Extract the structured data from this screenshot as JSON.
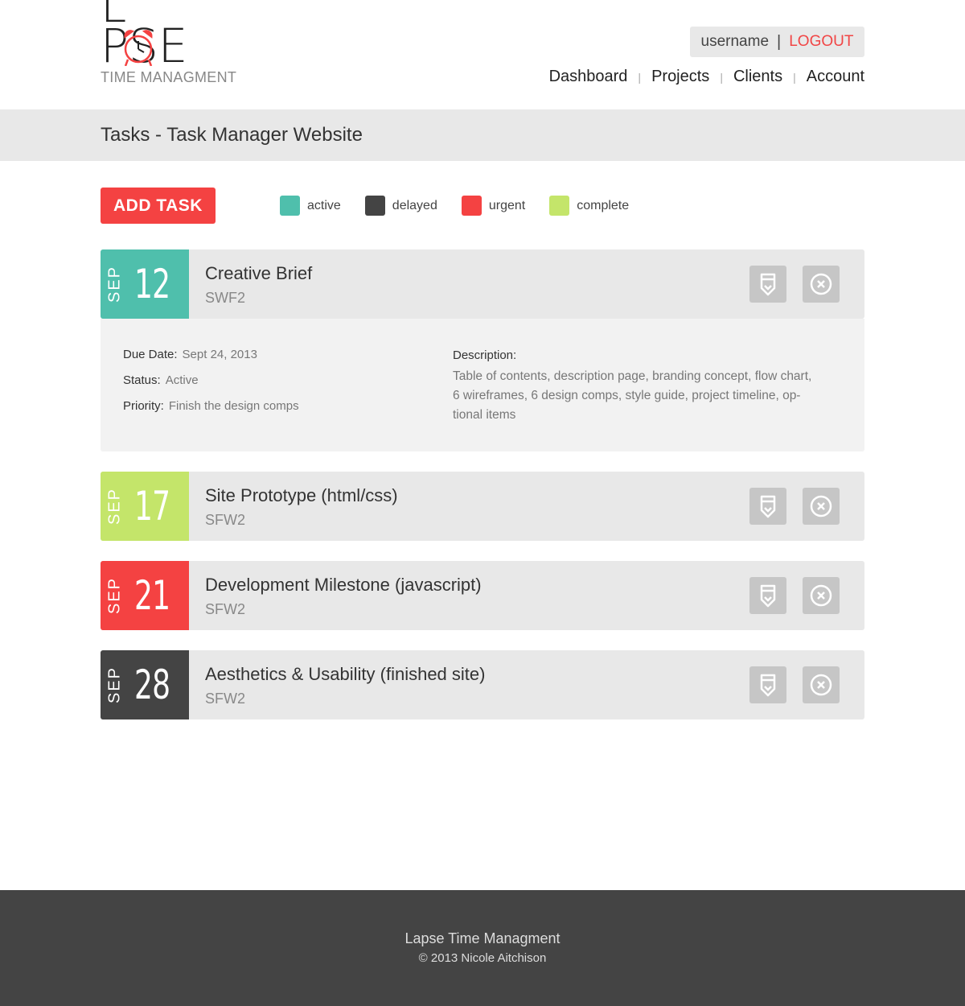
{
  "logo": {
    "word": "LAPSE",
    "tagline": "TIME MANAGMENT"
  },
  "user": {
    "username": "username",
    "separator": "|",
    "logout": "LOGOUT"
  },
  "nav": {
    "items": [
      "Dashboard",
      "Projects",
      "Clients",
      "Account"
    ]
  },
  "page": {
    "title": "Tasks - Task Manager Website"
  },
  "toolbar": {
    "add_task": "ADD TASK"
  },
  "legend": [
    {
      "label": "active",
      "color": "#4fbfac"
    },
    {
      "label": "delayed",
      "color": "#444444"
    },
    {
      "label": "urgent",
      "color": "#f44242"
    },
    {
      "label": "complete",
      "color": "#c4e56a"
    }
  ],
  "tasks": [
    {
      "month": "SEP",
      "day": "12",
      "title": "Creative Brief",
      "code": "SWF2",
      "status_color": "#4fbfac"
    },
    {
      "month": "SEP",
      "day": "17",
      "title": "Site Prototype (html/css)",
      "code": "SFW2",
      "status_color": "#c4e56a"
    },
    {
      "month": "SEP",
      "day": "21",
      "title": "Development Milestone (javascript)",
      "code": "SFW2",
      "status_color": "#f44242"
    },
    {
      "month": "SEP",
      "day": "28",
      "title": "Aesthetics & Usability (finished site)",
      "code": "SFW2",
      "status_color": "#444444"
    }
  ],
  "details": {
    "due_label": "Due Date:",
    "due_value": "Sept 24, 2013",
    "status_label": "Status:",
    "status_value": "Active",
    "priority_label": "Priority:",
    "priority_value": "Finish the design comps",
    "desc_label": "Description:",
    "desc_lines": [
      "Table of contents, description page, branding concept, flow chart,",
      "6 wireframes, 6 design comps, style guide, project timeline, op-",
      "tional items"
    ]
  },
  "icons": {
    "edit": "pencil-icon",
    "delete": "close-circle-icon",
    "logo_clock": "alarm-clock-icon"
  },
  "footer": {
    "title": "Lapse Time Managment",
    "copyright": "© 2013 Nicole Aitchison"
  }
}
